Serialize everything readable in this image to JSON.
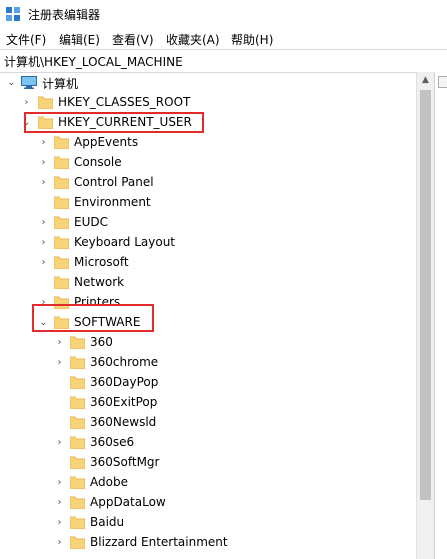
{
  "window": {
    "title": "注册表编辑器"
  },
  "menu": [
    {
      "label": "文件(F)"
    },
    {
      "label": "编辑(E)"
    },
    {
      "label": "查看(V)"
    },
    {
      "label": "收藏夹(A)"
    },
    {
      "label": "帮助(H)"
    }
  ],
  "address": {
    "path": "计算机\\HKEY_LOCAL_MACHINE"
  },
  "tree": {
    "root": {
      "label": "计算机"
    },
    "hives": [
      {
        "label": "HKEY_CLASSES_ROOT",
        "expanded": false
      },
      {
        "label": "HKEY_CURRENT_USER",
        "expanded": true,
        "highlighted": true
      }
    ],
    "current_user_children": [
      {
        "label": "AppEvents",
        "has_children": true
      },
      {
        "label": "Console",
        "has_children": true
      },
      {
        "label": "Control Panel",
        "has_children": true
      },
      {
        "label": "Environment",
        "has_children": false
      },
      {
        "label": "EUDC",
        "has_children": true
      },
      {
        "label": "Keyboard Layout",
        "has_children": true
      },
      {
        "label": "Microsoft",
        "has_children": true
      },
      {
        "label": "Network",
        "has_children": false
      },
      {
        "label": "Printers",
        "has_children": true
      },
      {
        "label": "SOFTWARE",
        "has_children": true,
        "expanded": true,
        "highlighted": true
      }
    ],
    "software_children": [
      {
        "label": "360",
        "has_children": true
      },
      {
        "label": "360chrome",
        "has_children": true
      },
      {
        "label": "360DayPop",
        "has_children": false
      },
      {
        "label": "360ExitPop",
        "has_children": false
      },
      {
        "label": "360Newsld",
        "has_children": false
      },
      {
        "label": "360se6",
        "has_children": true
      },
      {
        "label": "360SoftMgr",
        "has_children": false
      },
      {
        "label": "Adobe",
        "has_children": true
      },
      {
        "label": "AppDataLow",
        "has_children": true
      },
      {
        "label": "Baidu",
        "has_children": true
      },
      {
        "label": "Blizzard Entertainment",
        "has_children": true
      }
    ]
  },
  "colors": {
    "folder": "#f6d57a",
    "folder_dark": "#e8b84a",
    "highlight": "#e22b2b"
  },
  "icons": {
    "app": "registry-editor-icon",
    "computer": "computer-icon",
    "folder": "folder-icon",
    "chevron_right": "chevron-right-icon",
    "chevron_down": "chevron-down-icon"
  }
}
